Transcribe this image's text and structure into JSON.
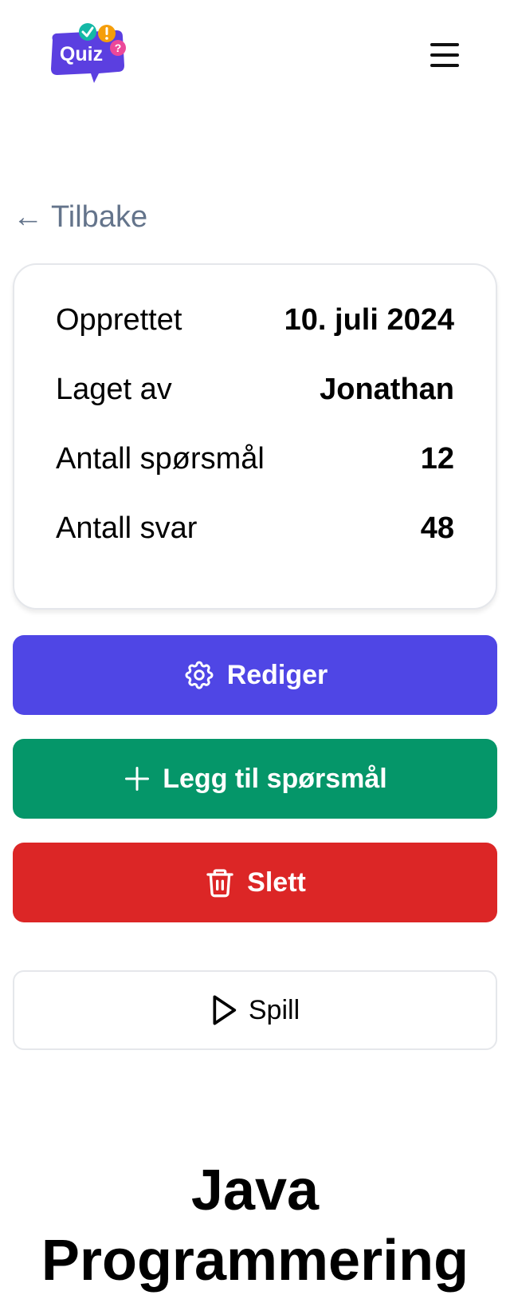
{
  "header": {
    "logo_text": "Quiz",
    "logo_colors": {
      "bubble": "#5b3fe0",
      "check": "#14b8a6",
      "alert": "#f59e0b",
      "question": "#ec4899"
    }
  },
  "nav": {
    "back_arrow": "←",
    "back_label": "Tilbake"
  },
  "info": {
    "rows": [
      {
        "label": "Opprettet",
        "value": "10. juli 2024"
      },
      {
        "label": "Laget av",
        "value": "Jonathan"
      },
      {
        "label": "Antall spørsmål",
        "value": "12"
      },
      {
        "label": "Antall svar",
        "value": "48"
      }
    ]
  },
  "actions": {
    "edit": {
      "label": "Rediger",
      "icon": "gear-icon",
      "color": "#4f46e5"
    },
    "add_question": {
      "label": "Legg til spørsmål",
      "icon": "plus-icon",
      "color": "#059669"
    },
    "delete": {
      "label": "Slett",
      "icon": "trash-icon",
      "color": "#dc2626"
    },
    "play": {
      "label": "Spill",
      "icon": "play-icon"
    }
  },
  "quiz": {
    "title": "Java Programmering"
  }
}
